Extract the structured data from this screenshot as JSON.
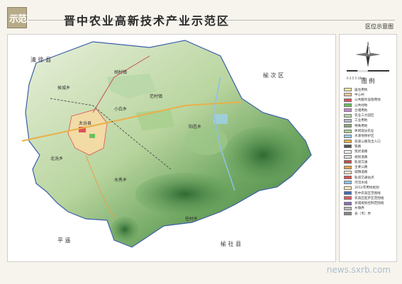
{
  "header": {
    "logo_text": "示范",
    "title": "晋中农业高新技术产业示范区",
    "subtitle": "区位示意图"
  },
  "map": {
    "county_labels": [
      {
        "id": "qingxu",
        "text": "清  徐  县"
      },
      {
        "id": "yuci",
        "text": "榆  次  区"
      },
      {
        "id": "pingyao",
        "text": "平  遥"
      },
      {
        "id": "yushe",
        "text": "榆  社  县"
      }
    ],
    "place_labels": [
      "太谷县",
      "胡村镇",
      "范村镇",
      "侯城乡",
      "阳邑乡",
      "小白乡",
      "北洸乡",
      "水秀乡",
      "任村乡"
    ]
  },
  "legend": {
    "north_label": "N",
    "scale_text": "0  2.5  5    10km",
    "title": "图  例",
    "items": [
      {
        "label": "居住用地",
        "color": "#f3e39b"
      },
      {
        "label": "中心村",
        "color": "#f2c6a0"
      },
      {
        "label": "公共服务设施用地",
        "color": "#e0505a"
      },
      {
        "label": "公共绿地",
        "color": "#6dbf5e"
      },
      {
        "label": "仓储用地",
        "color": "#c78ad0"
      },
      {
        "label": "农业三大园区",
        "color": "#b6d7a8"
      },
      {
        "label": "工业用地",
        "color": "#b7b7c9"
      },
      {
        "label": "特殊用地",
        "color": "#8fa87c"
      },
      {
        "label": "休闲观光农业",
        "color": "#a8d08d"
      },
      {
        "label": "水源地保护区",
        "color": "#9ecfe8"
      },
      {
        "label": "高速公路及出入口",
        "color": "#e9b04a"
      },
      {
        "label": "铁路",
        "color": "#555555"
      },
      {
        "label": "现状道路",
        "color": "#eeeeee"
      },
      {
        "label": "规划道路",
        "color": "#dcdcdc"
      },
      {
        "label": "轨道交通",
        "color": "#c0504d"
      },
      {
        "label": "主要公路",
        "color": "#e6a04a"
      },
      {
        "label": "城镇道路",
        "color": "#f1e1c4"
      },
      {
        "label": "轨道交通站点",
        "color": "#d9534f"
      },
      {
        "label": "河流水域",
        "color": "#8ec2e6"
      },
      {
        "label": "2012年用地规划",
        "color": "#fce8b2"
      },
      {
        "label": "晋中农高区范围线",
        "color": "#3d6fb6"
      },
      {
        "label": "农高区起步区范围线",
        "color": "#e15b5b"
      },
      {
        "label": "县城规划控制范围线",
        "color": "#8b6fb6"
      },
      {
        "label": "乡镇界",
        "color": "#bbbbbb"
      },
      {
        "label": "县（市）界",
        "color": "#888888"
      }
    ]
  },
  "footer": {
    "watermark": "news.sxrb.com"
  }
}
